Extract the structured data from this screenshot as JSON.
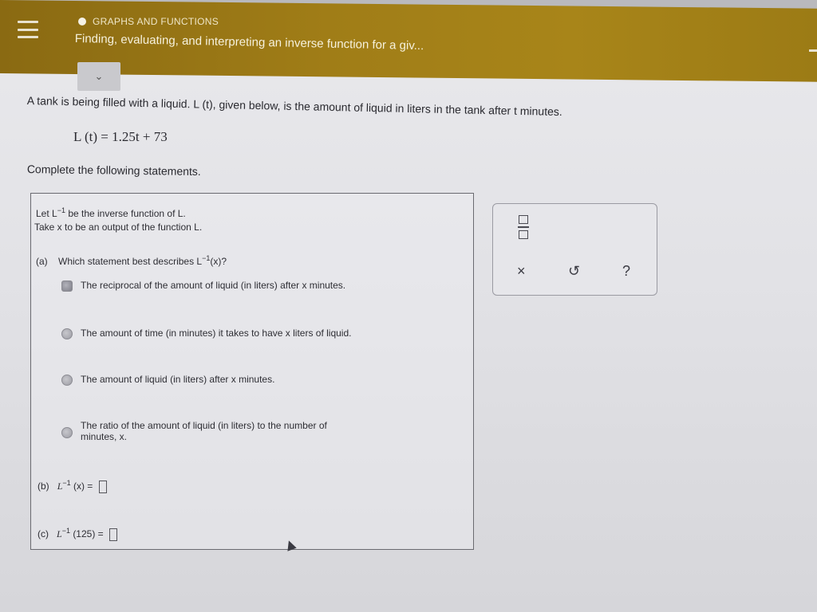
{
  "header": {
    "section": "GRAPHS AND FUNCTIONS",
    "topic": "Finding, evaluating, and interpreting an inverse function for a giv..."
  },
  "problem": {
    "prompt": "A tank is being filled with a liquid. L (t), given below, is the amount of liquid in liters in the tank after t minutes.",
    "equation": "L (t) = 1.25t + 73",
    "instructions": "Complete the following statements."
  },
  "question": {
    "let_line": "Let L",
    "let_sup": "−1",
    "let_rest": "be the inverse function of L.",
    "take_line": "Take x to be an output of the function L.",
    "part_a_prefix": "(a)",
    "part_a_text": "Which statement best describes L",
    "part_a_sup": "−1",
    "part_a_tail": "(x)?",
    "options": [
      "The reciprocal of the amount of liquid (in liters) after x minutes.",
      "The amount of time (in minutes) it takes to have x liters of liquid.",
      "The amount of liquid (in liters) after x minutes.",
      "The ratio of the amount of liquid (in liters) to the number of",
      "minutes, x."
    ],
    "part_b_prefix": "(b)",
    "part_b_expr": "L",
    "part_b_sup": "−1",
    "part_b_tail": "(x) =",
    "part_c_prefix": "(c)",
    "part_c_expr": "L",
    "part_c_sup": "−1",
    "part_c_tail": "(125) ="
  },
  "tools": {
    "clear": "×",
    "undo": "↺",
    "help": "?"
  }
}
